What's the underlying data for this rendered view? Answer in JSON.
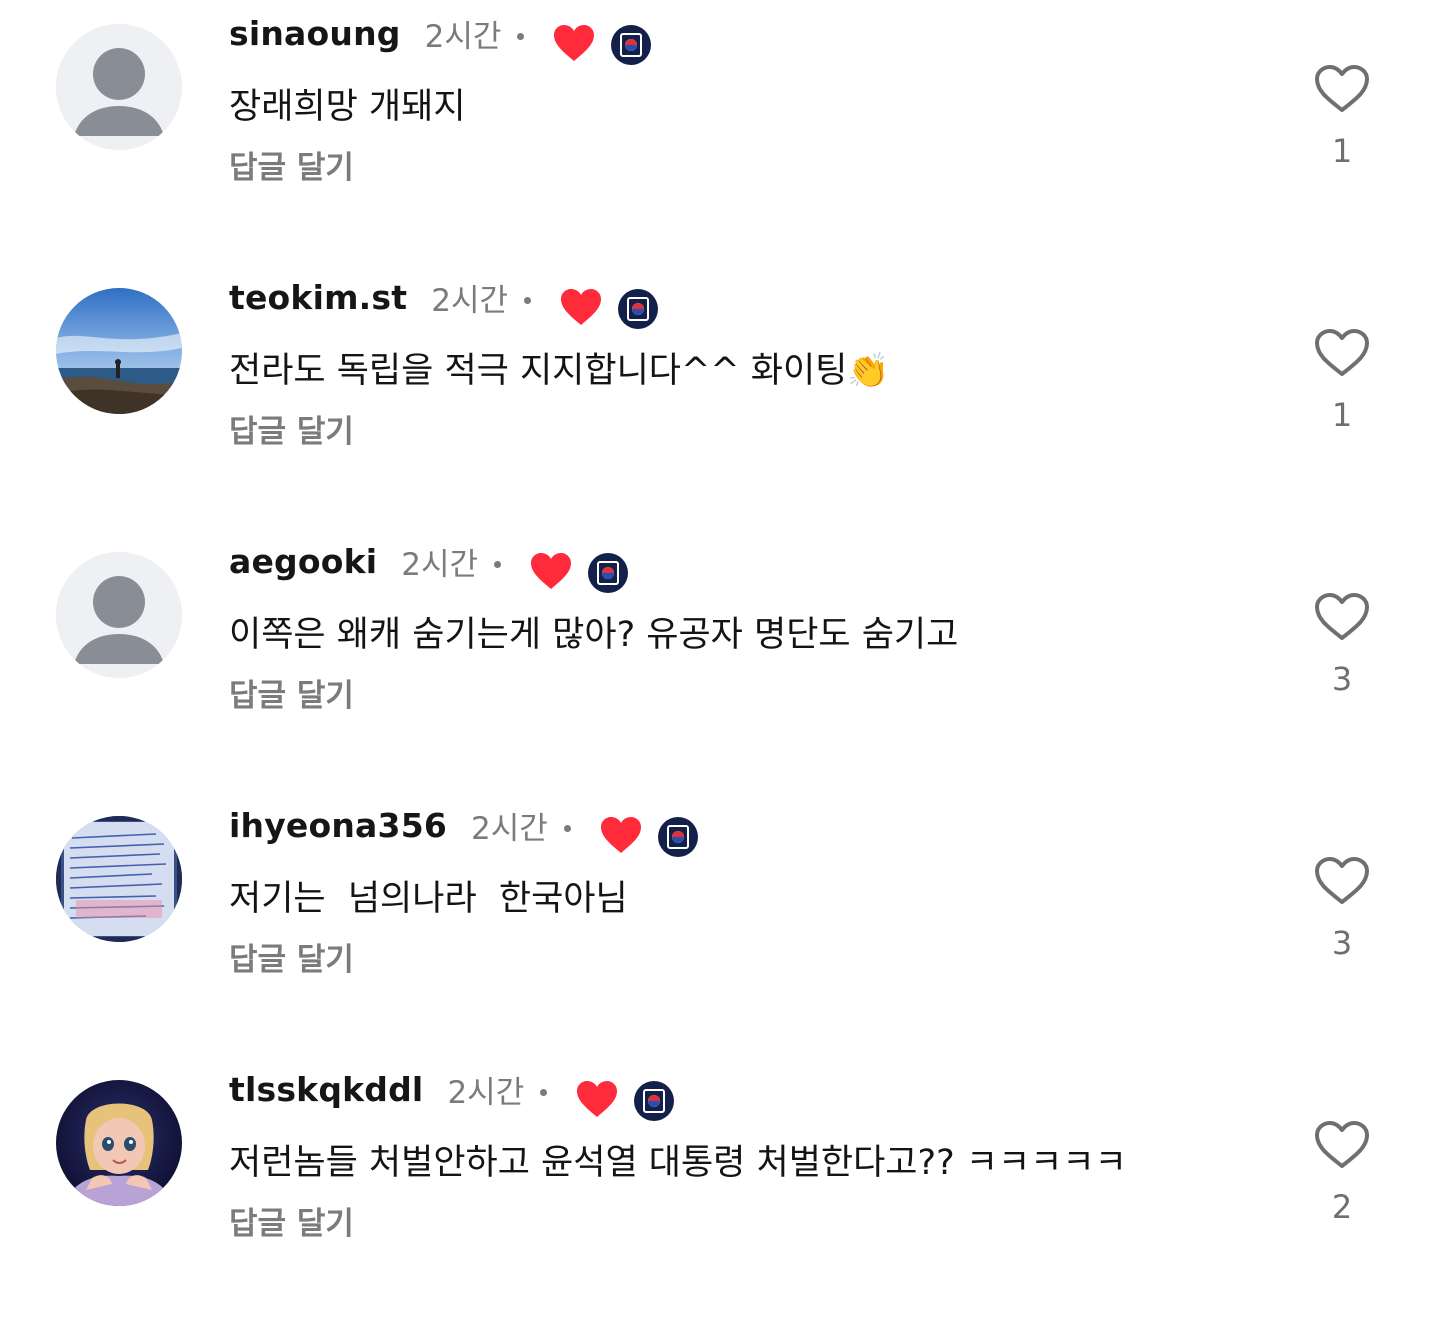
{
  "comments": [
    {
      "username": "sinaoung",
      "time": "2시간",
      "text": "장래희망 개돼지",
      "reply_label": "답글 달기",
      "likes": "1",
      "avatar": "default-person",
      "badge_heart_color": "#ff2a3a"
    },
    {
      "username": "teokim.st",
      "time": "2시간",
      "text": "전라도 독립을 적극 지지합니다^^ 화이팅",
      "emoji": "👏",
      "reply_label": "답글 달기",
      "likes": "1",
      "avatar": "photo-sea-sky",
      "badge_heart_color": "#ff2a3a"
    },
    {
      "username": "aegooki",
      "time": "2시간",
      "text": "이쪽은 왜캐 숨기는게 많아? 유공자 명단도 숨기고",
      "reply_label": "답글 달기",
      "likes": "3",
      "avatar": "default-person",
      "badge_heart_color": "#ff2a3a"
    },
    {
      "username": "ihyeona356",
      "time": "2시간",
      "text": "저기는  넘의나라  한국아님",
      "reply_label": "답글 달기",
      "likes": "3",
      "avatar": "photo-handwritten-notebook",
      "badge_heart_color": "#ff2a3a"
    },
    {
      "username": "tlsskqkddl",
      "time": "2시간",
      "text": "저런놈들 처벌안하고 윤석열 대통령 처벌한다고?? ㅋㅋㅋㅋㅋ",
      "reply_label": "답글 달기",
      "likes": "2",
      "avatar": "photo-cartoon-girl",
      "badge_heart_color": "#ff2a3a"
    }
  ],
  "colors": {
    "username": "#161616",
    "secondary_text": "#7b7b7b",
    "badge_navy": "#12204a",
    "heart_red": "#ff2a3a"
  },
  "icons": [
    "default-avatar-icon",
    "heart-badge-icon",
    "taegeuk-flag-badge-icon",
    "like-heart-icon",
    "clapping-hands-emoji"
  ]
}
